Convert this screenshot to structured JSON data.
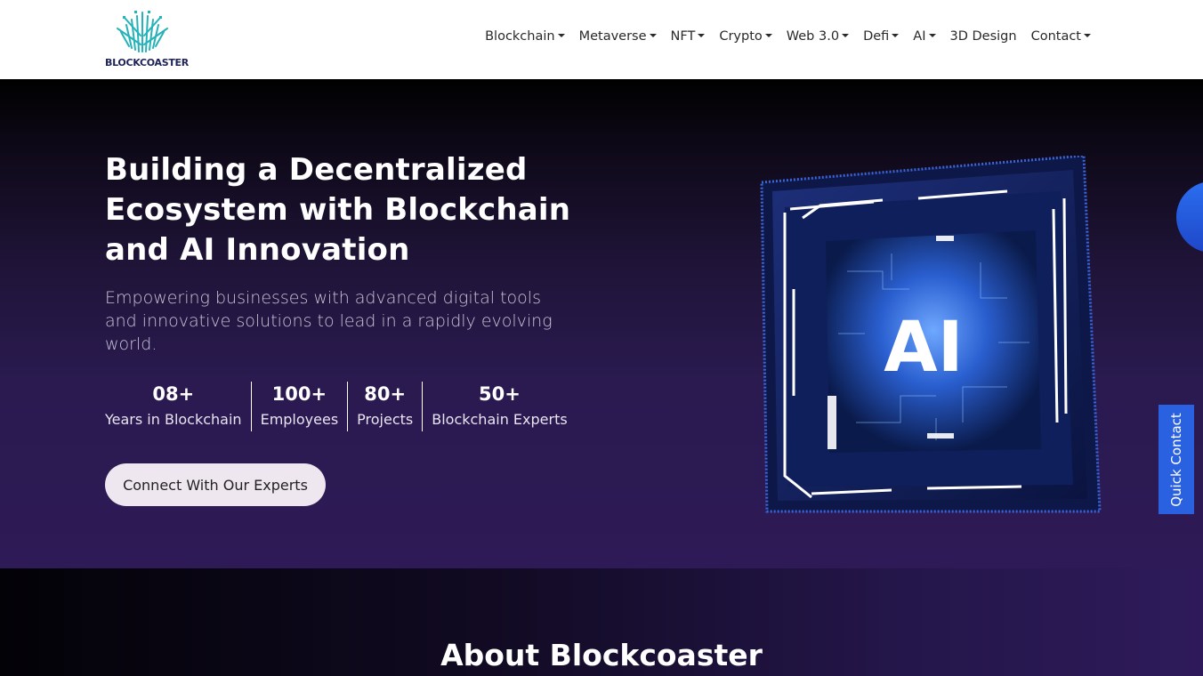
{
  "brand": {
    "name": "BLOCKCOASTER"
  },
  "nav": {
    "items": [
      {
        "label": "Blockchain",
        "dropdown": true
      },
      {
        "label": "Metaverse",
        "dropdown": true
      },
      {
        "label": "NFT",
        "dropdown": true
      },
      {
        "label": "Crypto",
        "dropdown": true
      },
      {
        "label": "Web 3.0",
        "dropdown": true
      },
      {
        "label": "Defi",
        "dropdown": true
      },
      {
        "label": "AI",
        "dropdown": true
      },
      {
        "label": "3D Design",
        "dropdown": false
      },
      {
        "label": "Contact",
        "dropdown": true
      }
    ]
  },
  "hero": {
    "title": "Building a Decentralized Ecosystem with Blockchain and AI Innovation",
    "subtitle": "Empowering businesses with advanced digital tools and innovative solutions to lead in a rapidly evolving world.",
    "stats": [
      {
        "number": "08+",
        "label": "Years in Blockchain"
      },
      {
        "number": "100+",
        "label": "Employees"
      },
      {
        "number": "80+",
        "label": "Projects"
      },
      {
        "number": "50+",
        "label": "Blockchain Experts"
      }
    ],
    "cta_label": "Connect With Our Experts",
    "art_text": "AI"
  },
  "quick_contact": {
    "label": "Quick Contact"
  },
  "about": {
    "title": "About Blockcoaster"
  },
  "colors": {
    "accent_blue": "#2a61e0",
    "hero_purple": "#2e1a56",
    "logo_teal": "#23b3b8",
    "logo_navy": "#1e2358"
  },
  "icons": {
    "logo": "blockcoaster-logo-icon",
    "caret": "chevron-down-icon"
  }
}
